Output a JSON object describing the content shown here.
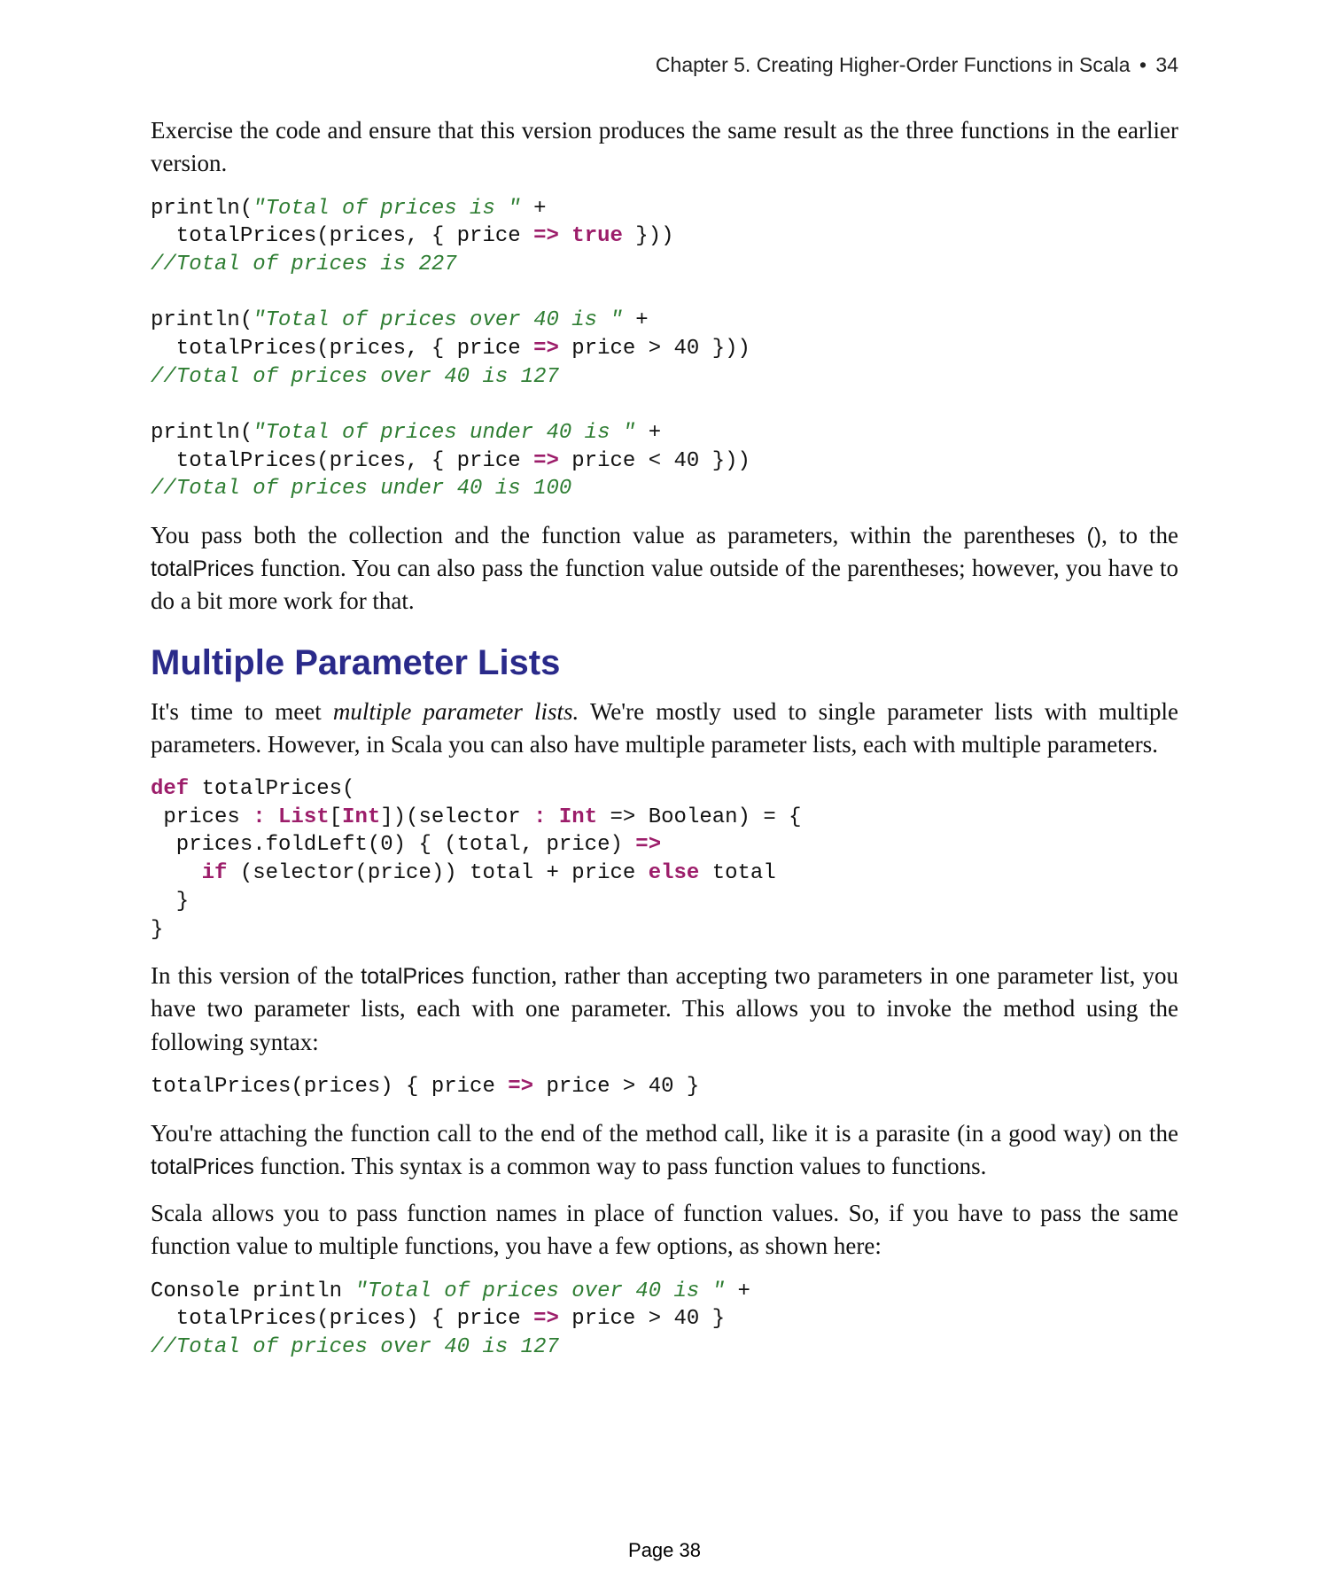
{
  "header": {
    "chapter": "Chapter 5. Creating Higher-Order Functions in Scala",
    "bullet": "•",
    "pagemark": "34"
  },
  "para1": "Exercise the code and ensure that this version produces the same result as the three functions in the earlier version.",
  "code1": {
    "l1a": "println(",
    "l1b": "\"Total of prices is \"",
    "l1c": " +",
    "l2a": "  totalPrices(prices, { price ",
    "l2b": "=>",
    "l2c": " ",
    "l2d": "true",
    "l2e": " }))",
    "l3": "//Total of prices is 227",
    "l4a": "println(",
    "l4b": "\"Total of prices over 40 is \"",
    "l4c": " +",
    "l5a": "  totalPrices(prices, { price ",
    "l5b": "=>",
    "l5c": " price > 40 }))",
    "l6": "//Total of prices over 40 is 127",
    "l7a": "println(",
    "l7b": "\"Total of prices under 40 is \"",
    "l7c": " +",
    "l8a": "  totalPrices(prices, { price ",
    "l8b": "=>",
    "l8c": " price < 40 }))",
    "l9": "//Total of prices under 40 is 100"
  },
  "para2a": "You pass both the collection and the function value as parameters, within the parentheses ",
  "para2b": "()",
  "para2c": ", to the ",
  "para2d": "totalPrices",
  "para2e": " function. You can also pass the function value outside of the parentheses; however, you have to do a bit more work for that.",
  "heading": "Multiple Parameter Lists",
  "para3a": "It's time to meet ",
  "para3b": "multiple parameter lists.",
  "para3c": " We're mostly used to single parameter lists with multiple parameters. However, in Scala you can also have multiple parameter lists, each with multiple parameters.",
  "code2": {
    "l1a": "def",
    "l1b": " totalPrices(",
    "l2a": " prices ",
    "l2b": ":",
    "l2c": " ",
    "l2d": "List",
    "l2e": "[",
    "l2f": "Int",
    "l2g": "])(selector ",
    "l2h": ":",
    "l2i": " ",
    "l2j": "Int",
    "l2k": " => Boolean) = {",
    "l3a": "  prices.foldLeft(0) { (total, price) ",
    "l3b": "=>",
    "l4a": "    ",
    "l4b": "if",
    "l4c": " (selector(price)) total + price ",
    "l4d": "else",
    "l4e": " total",
    "l5": "  }",
    "l6": "}"
  },
  "para4a": "In this version of the ",
  "para4b": "totalPrices",
  "para4c": " function, rather than accepting two parameters in one parameter list, you have two parameter lists, each with one parameter. This allows you to invoke the method using the following syntax:",
  "code3": {
    "l1a": "totalPrices(prices) { price ",
    "l1b": "=>",
    "l1c": " price > 40 }"
  },
  "para5a": "You're attaching the function call to the end of the method call, like it is a parasite (in a good way) on the ",
  "para5b": "totalPrices",
  "para5c": " function. This syntax is a common way to pass function values to functions.",
  "para6": "Scala allows you to pass function names in place of function values. So, if you have to pass the same function value to multiple functions, you have a few options, as shown here:",
  "code4": {
    "l1a": "Console println ",
    "l1b": "\"Total of prices over 40 is \"",
    "l1c": " +",
    "l2a": "  totalPrices(prices) { price ",
    "l2b": "=>",
    "l2c": " price > 40 }",
    "l3": "//Total of prices over 40 is 127"
  },
  "footer": "Page 38"
}
